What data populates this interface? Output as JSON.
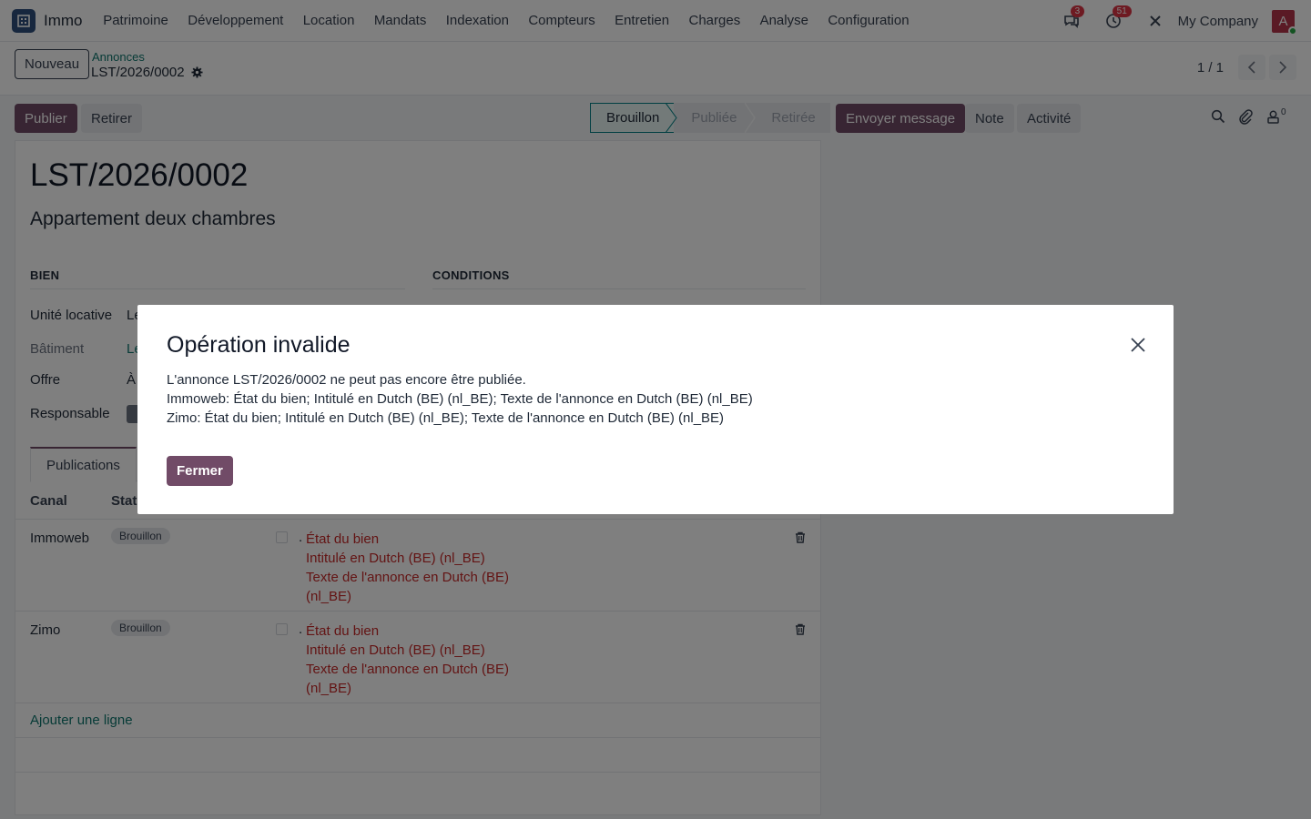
{
  "navbar": {
    "app_name": "Immo",
    "menu": [
      "Patrimoine",
      "Développement",
      "Location",
      "Mandats",
      "Indexation",
      "Compteurs",
      "Entretien",
      "Charges",
      "Analyse",
      "Configuration"
    ],
    "messages_count": "3",
    "activities_count": "51",
    "company": "My Company",
    "avatar_initial": "A",
    "icons": [
      "grid-app-icon",
      "chat-icon",
      "clock-icon",
      "tools-icon"
    ]
  },
  "control": {
    "new_button": "Nouveau",
    "breadcrumb_parent": "Annonces",
    "breadcrumb_current": "LST/2026/0002",
    "pager": "1 / 1"
  },
  "actions": {
    "publish": "Publier",
    "withdraw": "Retirer",
    "stages": [
      "Brouillon",
      "Publiée",
      "Retirée"
    ],
    "active_stage": "Brouillon"
  },
  "chatter": {
    "send_message": "Envoyer message",
    "note": "Note",
    "activity": "Activité",
    "followers_count": "0"
  },
  "form": {
    "title": "LST/2026/0002",
    "subtitle": "Appartement deux chambres",
    "group_bien": "BIEN",
    "group_conditions": "CONDITIONS",
    "fields": {
      "unite_locative": {
        "label": "Unité locative",
        "value": "Le"
      },
      "batiment": {
        "label": "Bâtiment",
        "value": "Le"
      },
      "offre": {
        "label": "Offre",
        "value": "À"
      },
      "responsable": {
        "label": "Responsable"
      }
    },
    "tab": "Publications",
    "columns": {
      "canal": "Canal",
      "statut": "Stat"
    },
    "rows": [
      {
        "canal": "Immoweb",
        "status": "Brouillon",
        "dot": ".",
        "errors": [
          "État du bien",
          "Intitulé en Dutch (BE) (nl_BE)",
          "Texte de l'annonce en Dutch (BE)",
          "(nl_BE)"
        ]
      },
      {
        "canal": "Zimo",
        "status": "Brouillon",
        "dot": ".",
        "errors": [
          "État du bien",
          "Intitulé en Dutch (BE) (nl_BE)",
          "Texte de l'annonce en Dutch (BE)",
          "(nl_BE)"
        ]
      }
    ],
    "add_line": "Ajouter une ligne"
  },
  "modal": {
    "title": "Opération invalide",
    "lines": [
      "L'annonce LST/2026/0002 ne peut pas encore être publiée.",
      "Immoweb: État du bien; Intitulé en Dutch (BE) (nl_BE); Texte de l'annonce en Dutch (BE) (nl_BE)",
      "Zimo: État du bien; Intitulé en Dutch (BE) (nl_BE); Texte de l'annonce en Dutch (BE) (nl_BE)"
    ],
    "close_button": "Fermer"
  },
  "colors": {
    "primary": "#714b67",
    "link": "#0f766e",
    "danger": "#c62828",
    "badge_red": "#dc3545"
  }
}
